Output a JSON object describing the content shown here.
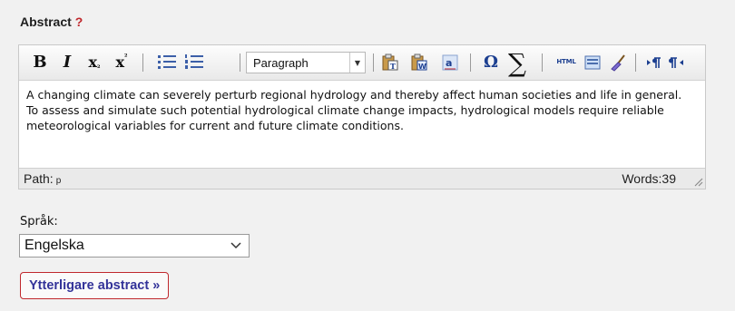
{
  "field": {
    "label": "Abstract",
    "required_mark": "?"
  },
  "toolbar": {
    "buttons": [
      {
        "name": "bold",
        "label": "B"
      },
      {
        "name": "italic",
        "label": "I"
      },
      {
        "name": "subscript",
        "label": "x"
      },
      {
        "name": "superscript",
        "label": "x"
      }
    ],
    "format_select": "Paragraph",
    "html_label": "HTML",
    "omega": "Ω",
    "sigma": "∑"
  },
  "editor": {
    "text": "A changing climate can severely perturb regional hydrology and thereby affect human societies and life in general. To assess and simulate such potential hydrological climate change impacts, hydrological models require reliable meteorological variables for current and future climate conditions."
  },
  "statusbar": {
    "path_label": "Path:",
    "path_value": "p",
    "words_label": "Words:39"
  },
  "language": {
    "label": "Språk:",
    "selected": "Engelska"
  },
  "more_button": {
    "label": "Ytterligare abstract »"
  },
  "colors": {
    "required": "#c0282d",
    "link": "#333399",
    "icon_blue": "#1c3f90"
  },
  "icons": [
    "bullet-list-icon",
    "numbered-list-icon",
    "paste-text-icon",
    "paste-word-icon",
    "spellcheck-icon",
    "omega-icon",
    "sigma-icon",
    "html-icon",
    "template-icon",
    "cleanup-icon",
    "ltr-icon",
    "rtl-icon",
    "resize-grip-icon",
    "chevron-down-icon"
  ]
}
